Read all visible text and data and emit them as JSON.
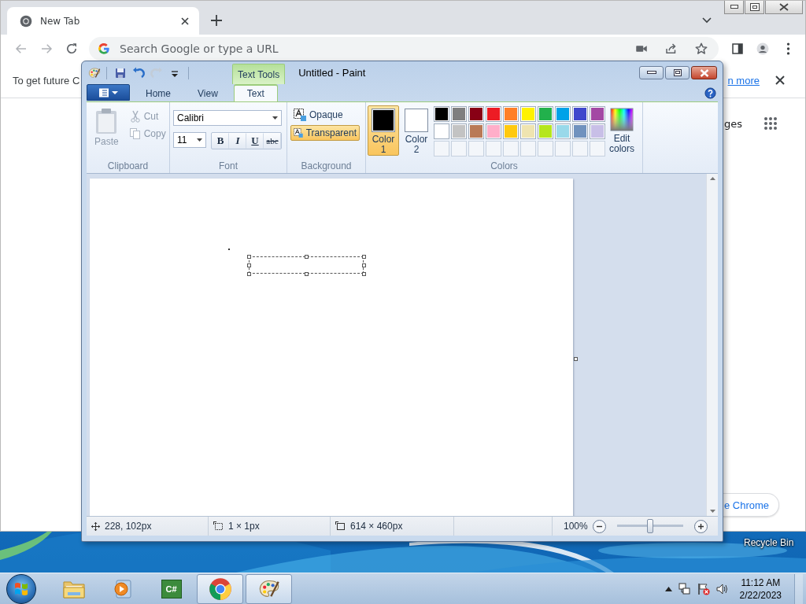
{
  "browser": {
    "tabs": [
      {
        "title": "New Tab",
        "selected": true
      }
    ],
    "address_bar": {
      "placeholder": "Search Google or type a URL"
    },
    "infobar": {
      "message": "To get future C",
      "link": "n more"
    },
    "shortcut_label": "ges",
    "customize_button": "e Chrome"
  },
  "paint": {
    "contextual_tab": "Text Tools",
    "title": "Untitled - Paint",
    "quick_access": [
      {
        "kind": "save",
        "disabled": false
      },
      {
        "kind": "undo",
        "disabled": false
      },
      {
        "kind": "redo",
        "disabled": true
      },
      {
        "kind": "customize",
        "disabled": false
      }
    ],
    "tabs": [
      {
        "label": "Home",
        "selected": false
      },
      {
        "label": "View",
        "selected": false
      },
      {
        "label": "Text",
        "selected": true
      }
    ],
    "clipboard": {
      "label": "Clipboard",
      "paste": {
        "label": "Paste",
        "disabled": true
      },
      "cut": {
        "label": "Cut",
        "disabled": true
      },
      "copy": {
        "label": "Copy",
        "disabled": true
      }
    },
    "font": {
      "label": "Font",
      "family": "Calibri",
      "size": "11",
      "styles": [
        {
          "label": "B",
          "kind": "bold"
        },
        {
          "label": "I",
          "kind": "italic"
        },
        {
          "label": "U",
          "kind": "underline"
        },
        {
          "label": "abc",
          "kind": "strike"
        }
      ]
    },
    "background": {
      "label": "Background",
      "options": [
        {
          "label": "Opaque",
          "selected": false
        },
        {
          "label": "Transparent",
          "selected": true
        }
      ]
    },
    "colors": {
      "label": "Colors",
      "slots": [
        {
          "label": "Color 1",
          "color": "#000000",
          "selected": true
        },
        {
          "label": "Color 2",
          "color": "#ffffff",
          "selected": false
        }
      ],
      "palette": [
        {
          "color": "#000000"
        },
        {
          "color": "#7f7f7f"
        },
        {
          "color": "#880015"
        },
        {
          "color": "#ed1c24"
        },
        {
          "color": "#ff7f27"
        },
        {
          "color": "#fff200"
        },
        {
          "color": "#22b14c"
        },
        {
          "color": "#00a2e8"
        },
        {
          "color": "#3f48cc"
        },
        {
          "color": "#a349a4"
        },
        {
          "color": "#ffffff"
        },
        {
          "color": "#c3c3c3"
        },
        {
          "color": "#b97a57"
        },
        {
          "color": "#ffaec9"
        },
        {
          "color": "#ffc90e"
        },
        {
          "color": "#efe4b0"
        },
        {
          "color": "#b5e61d"
        },
        {
          "color": "#99d9ea"
        },
        {
          "color": "#7092be"
        },
        {
          "color": "#c8bfe7"
        }
      ],
      "edit": "Edit colors"
    },
    "status": {
      "position": "228, 102px",
      "selection": "1 × 1px",
      "size": "614 × 460px",
      "zoom": "100%",
      "level": 0.5
    }
  },
  "desktop": {
    "icons": [
      {
        "label": "Recycle Bin"
      }
    ]
  },
  "taskbar": {
    "apps": [
      {
        "kind": "explorer",
        "active": false
      },
      {
        "kind": "media",
        "active": false
      },
      {
        "kind": "csharp",
        "label": "C#",
        "active": false
      },
      {
        "kind": "chrome",
        "active": true
      },
      {
        "kind": "paint",
        "active": true
      }
    ],
    "time": "11:12 AM",
    "date": "2/22/2023"
  }
}
